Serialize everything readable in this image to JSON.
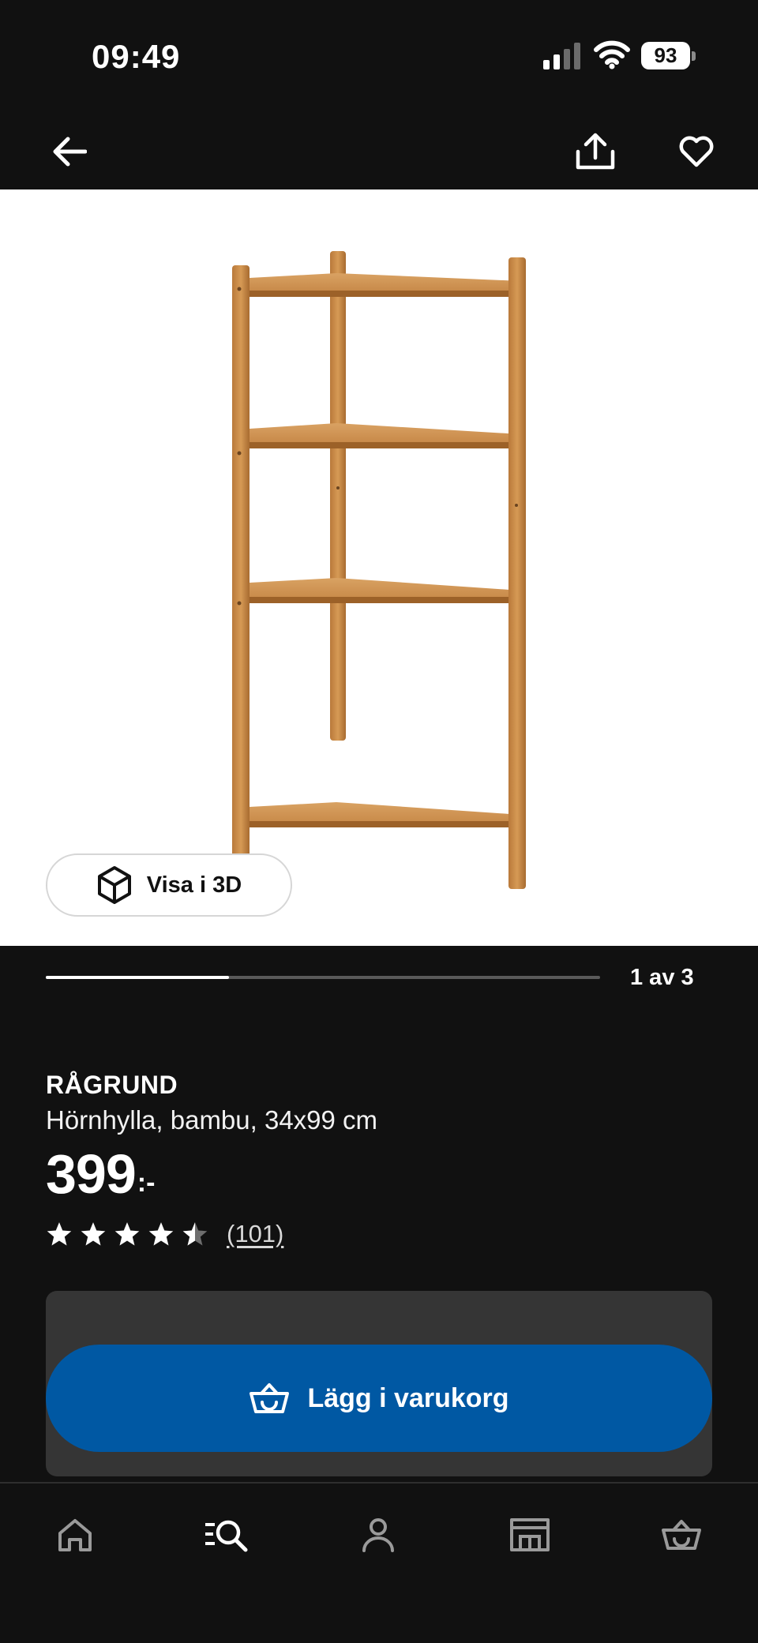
{
  "status_bar": {
    "time": "09:49",
    "battery": "93",
    "icons": [
      "signal-icon",
      "wifi-icon",
      "battery-icon"
    ]
  },
  "top_nav": {
    "icons": [
      "back-arrow-icon",
      "share-icon",
      "heart-icon"
    ]
  },
  "product": {
    "image_icon": "corner-shelf-image",
    "view_3d_label": "Visa i 3D",
    "gallery_page": "1 av 3",
    "gallery_progress": 0.33,
    "name": "RÅGRUND",
    "description": "Hörnhylla, bambu, 34x99 cm",
    "price": "399",
    "price_suffix": ":-",
    "rating": 4.5,
    "review_count": "(101)"
  },
  "actions": {
    "add_to_cart_label": "Lägg i varukorg",
    "cart_icon": "basket-icon"
  },
  "tab_bar": {
    "tabs": [
      "home-icon",
      "search-icon",
      "profile-icon",
      "store-icon",
      "basket-icon"
    ],
    "active": "search-icon"
  },
  "colors": {
    "background": "#111111",
    "accent": "#0058a3",
    "panel": "#353535",
    "wood": "#c98a45"
  }
}
